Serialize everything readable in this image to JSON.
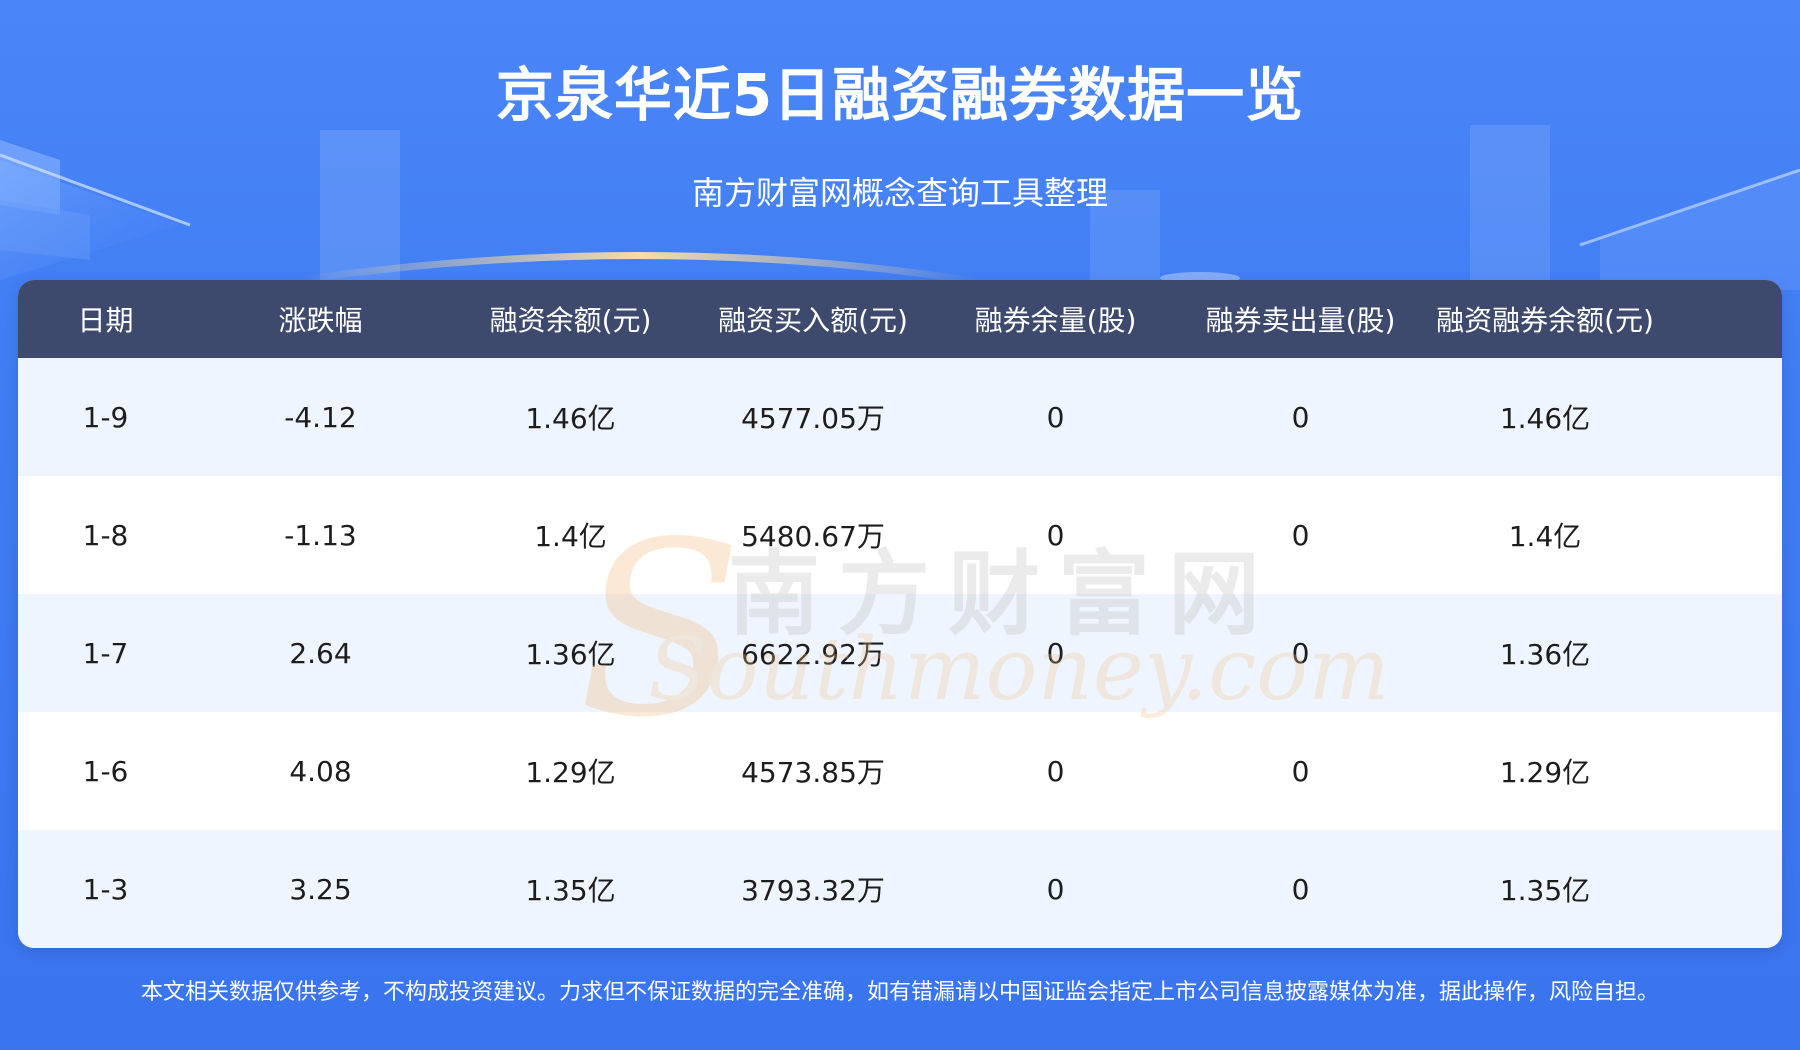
{
  "header": {
    "title": "京泉华近5日融资融券数据一览",
    "subtitle": "南方财富网概念查询工具整理"
  },
  "table": {
    "columns": [
      "日期",
      "涨跌幅",
      "融资余额(元)",
      "融资买入额(元)",
      "融券余量(股)",
      "融券卖出量(股)",
      "融资融券余额(元)"
    ],
    "rows": [
      [
        "1-9",
        "-4.12",
        "1.46亿",
        "4577.05万",
        "0",
        "0",
        "1.46亿"
      ],
      [
        "1-8",
        "-1.13",
        "1.4亿",
        "5480.67万",
        "0",
        "0",
        "1.4亿"
      ],
      [
        "1-7",
        "2.64",
        "1.36亿",
        "6622.92万",
        "0",
        "0",
        "1.36亿"
      ],
      [
        "1-6",
        "4.08",
        "1.29亿",
        "4573.85万",
        "0",
        "0",
        "1.29亿"
      ],
      [
        "1-3",
        "3.25",
        "1.35亿",
        "3793.32万",
        "0",
        "0",
        "1.35亿"
      ]
    ]
  },
  "watermark": {
    "cn": "南方财富网",
    "en": "Southmoney.com",
    "logo_letter": "S"
  },
  "footer": {
    "disclaimer": "本文相关数据仅供参考，不构成投资建议。力求但不保证数据的完全准确，如有错漏请以中国证监会指定上市公司信息披露媒体为准，据此操作，风险自担。"
  },
  "colors": {
    "background": "#3f7cf3",
    "header_row": "#3d4a6d",
    "stripe_row": "#eef5ff"
  }
}
